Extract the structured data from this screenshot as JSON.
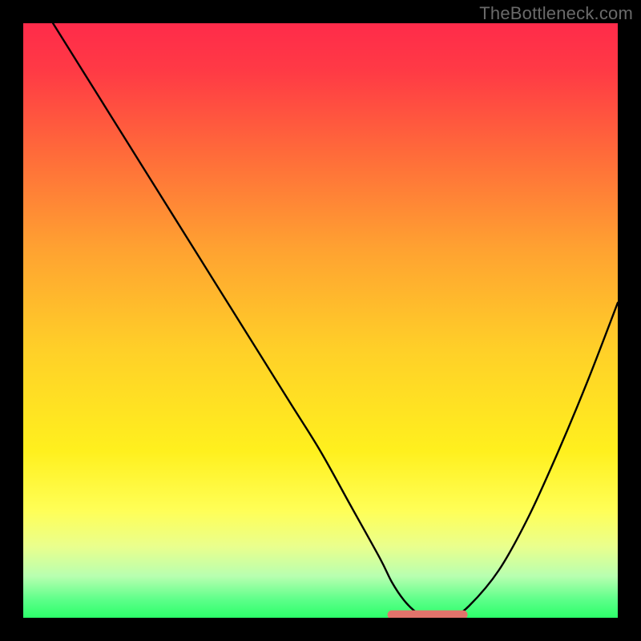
{
  "watermark": "TheBottleneck.com",
  "chart_data": {
    "type": "line",
    "title": "",
    "xlabel": "",
    "ylabel": "",
    "xlim": [
      0,
      100
    ],
    "ylim": [
      0,
      100
    ],
    "x": [
      5,
      10,
      15,
      20,
      25,
      30,
      35,
      40,
      45,
      50,
      55,
      60,
      62,
      64,
      66,
      68,
      70,
      72,
      75,
      80,
      85,
      90,
      95,
      100
    ],
    "values": [
      100,
      92,
      84,
      76,
      68,
      60,
      52,
      44,
      36,
      28,
      19,
      10,
      6,
      3,
      1,
      0,
      0,
      0,
      2,
      8,
      17,
      28,
      40,
      53
    ],
    "annotations": [
      {
        "label": "flat-min-band",
        "x_from": 62,
        "x_to": 74,
        "y": 0.5
      }
    ],
    "colors": {
      "curve": "#000000",
      "min_band": "#e2736b",
      "gradient_top": "#ff2b4a",
      "gradient_bottom": "#2cff6a"
    }
  }
}
